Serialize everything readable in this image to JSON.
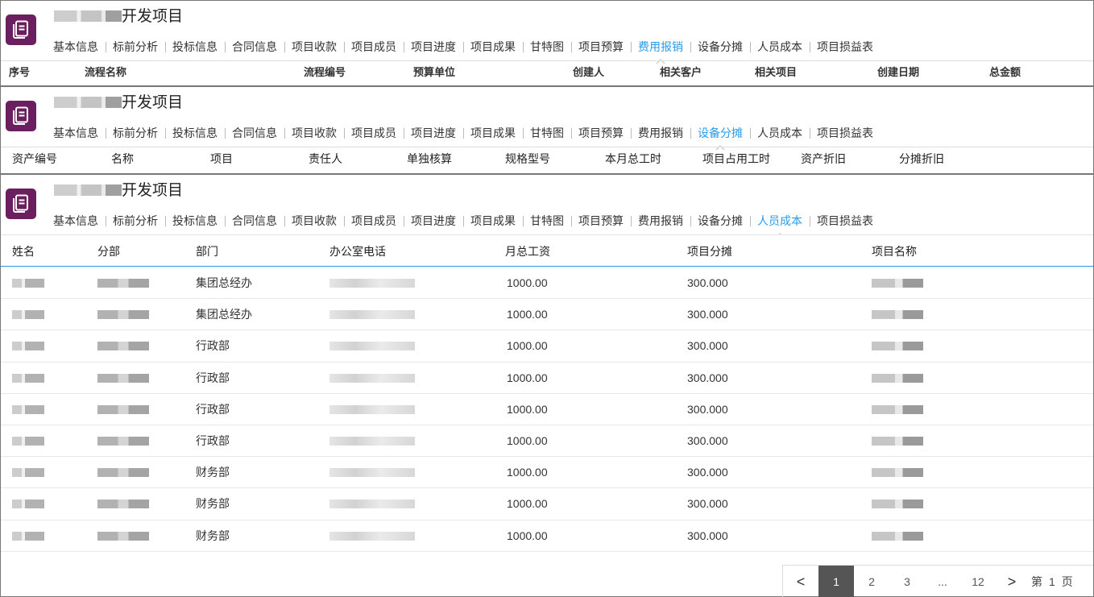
{
  "project_title": "开发项目",
  "tabs": [
    "基本信息",
    "标前分析",
    "投标信息",
    "合同信息",
    "项目收款",
    "项目成员",
    "项目进度",
    "项目成果",
    "甘特图",
    "项目预算",
    "费用报销",
    "设备分摊",
    "人员成本",
    "项目损益表"
  ],
  "panel1": {
    "active_tab": "费用报销",
    "columns": [
      "序号",
      "流程名称",
      "流程编号",
      "预算单位",
      "创建人",
      "相关客户",
      "相关项目",
      "创建日期",
      "总金额"
    ]
  },
  "panel2": {
    "active_tab": "设备分摊",
    "columns": [
      "资产编号",
      "名称",
      "项目",
      "责任人",
      "单独核算",
      "规格型号",
      "本月总工时",
      "项目占用工时",
      "资产折旧",
      "分摊折旧"
    ]
  },
  "panel3": {
    "active_tab": "人员成本",
    "columns": [
      "姓名",
      "分部",
      "部门",
      "办公室电话",
      "月总工资",
      "项目分摊",
      "项目名称"
    ],
    "rows": [
      {
        "dept": "集团总经办",
        "salary": "1000.00",
        "share": "300.000"
      },
      {
        "dept": "集团总经办",
        "salary": "1000.00",
        "share": "300.000"
      },
      {
        "dept": "行政部",
        "salary": "1000.00",
        "share": "300.000"
      },
      {
        "dept": "行政部",
        "salary": "1000.00",
        "share": "300.000"
      },
      {
        "dept": "行政部",
        "salary": "1000.00",
        "share": "300.000"
      },
      {
        "dept": "行政部",
        "salary": "1000.00",
        "share": "300.000"
      },
      {
        "dept": "财务部",
        "salary": "1000.00",
        "share": "300.000"
      },
      {
        "dept": "财务部",
        "salary": "1000.00",
        "share": "300.000"
      },
      {
        "dept": "财务部",
        "salary": "1000.00",
        "share": "300.000"
      }
    ]
  },
  "pager": {
    "prev": "<",
    "pages": [
      "1",
      "2",
      "3"
    ],
    "ellipsis": "...",
    "last": "12",
    "next": ">",
    "jump_prefix": "第",
    "current": "1",
    "jump_suffix": "页"
  },
  "colors": {
    "accent": "#2a9be8",
    "icon_bg": "#6b1f5e",
    "pager_active": "#555555"
  },
  "icon": "document-list-icon"
}
